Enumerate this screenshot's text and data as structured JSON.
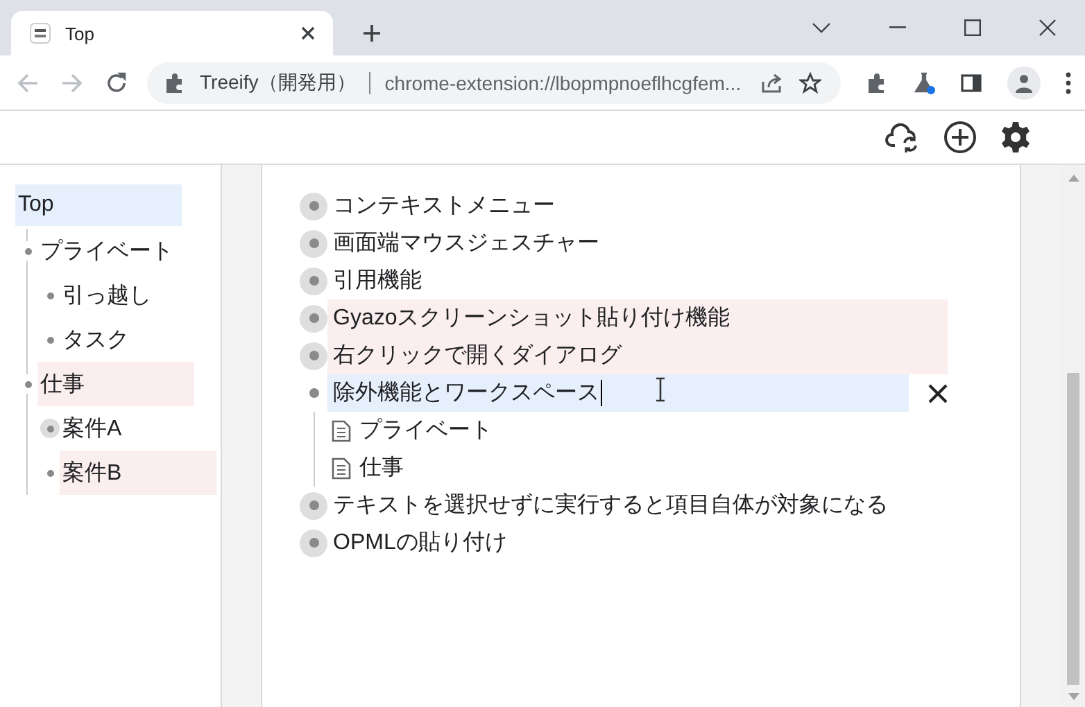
{
  "browser": {
    "tab": {
      "title": "Top"
    },
    "address": {
      "site_name": "Treeify（開発用）",
      "url": "chrome-extension://lbopmpnoeflhcgfem..."
    }
  },
  "sidebar": {
    "items": [
      {
        "label": "Top",
        "selected": true,
        "tinted": false,
        "collapsed": false,
        "children": [
          {
            "label": "プライベート",
            "selected": false,
            "tinted": false,
            "collapsed": false,
            "children": [
              {
                "label": "引っ越し",
                "selected": false,
                "tinted": false,
                "collapsed": false
              },
              {
                "label": "タスク",
                "selected": false,
                "tinted": false,
                "collapsed": false
              }
            ]
          },
          {
            "label": "仕事",
            "selected": false,
            "tinted": true,
            "collapsed": false,
            "children": [
              {
                "label": "案件A",
                "selected": false,
                "tinted": false,
                "collapsed": true
              },
              {
                "label": "案件B",
                "selected": false,
                "tinted": true,
                "collapsed": false
              }
            ]
          }
        ]
      }
    ]
  },
  "outline": {
    "items": [
      {
        "label": "コンテキストメニュー",
        "selected": false,
        "tinted": false,
        "collapsed": true
      },
      {
        "label": "画面端マウスジェスチャー",
        "selected": false,
        "tinted": false,
        "collapsed": true
      },
      {
        "label": "引用機能",
        "selected": false,
        "tinted": false,
        "collapsed": true
      },
      {
        "label": "Gyazoスクリーンショット貼り付け機能",
        "selected": false,
        "tinted": true,
        "collapsed": true
      },
      {
        "label": "右クリックで開くダイアログ",
        "selected": false,
        "tinted": true,
        "collapsed": true
      },
      {
        "label": "除外機能とワークスペース",
        "selected": true,
        "tinted": false,
        "collapsed": false,
        "children": [
          {
            "kind": "link",
            "label": "プライベート"
          },
          {
            "kind": "link",
            "label": "仕事"
          }
        ]
      },
      {
        "label": "テキストを選択せずに実行すると項目自体が対象になる",
        "selected": false,
        "tinted": false,
        "collapsed": true
      },
      {
        "label": "OPMLの貼り付け",
        "selected": false,
        "tinted": false,
        "collapsed": true
      }
    ]
  }
}
